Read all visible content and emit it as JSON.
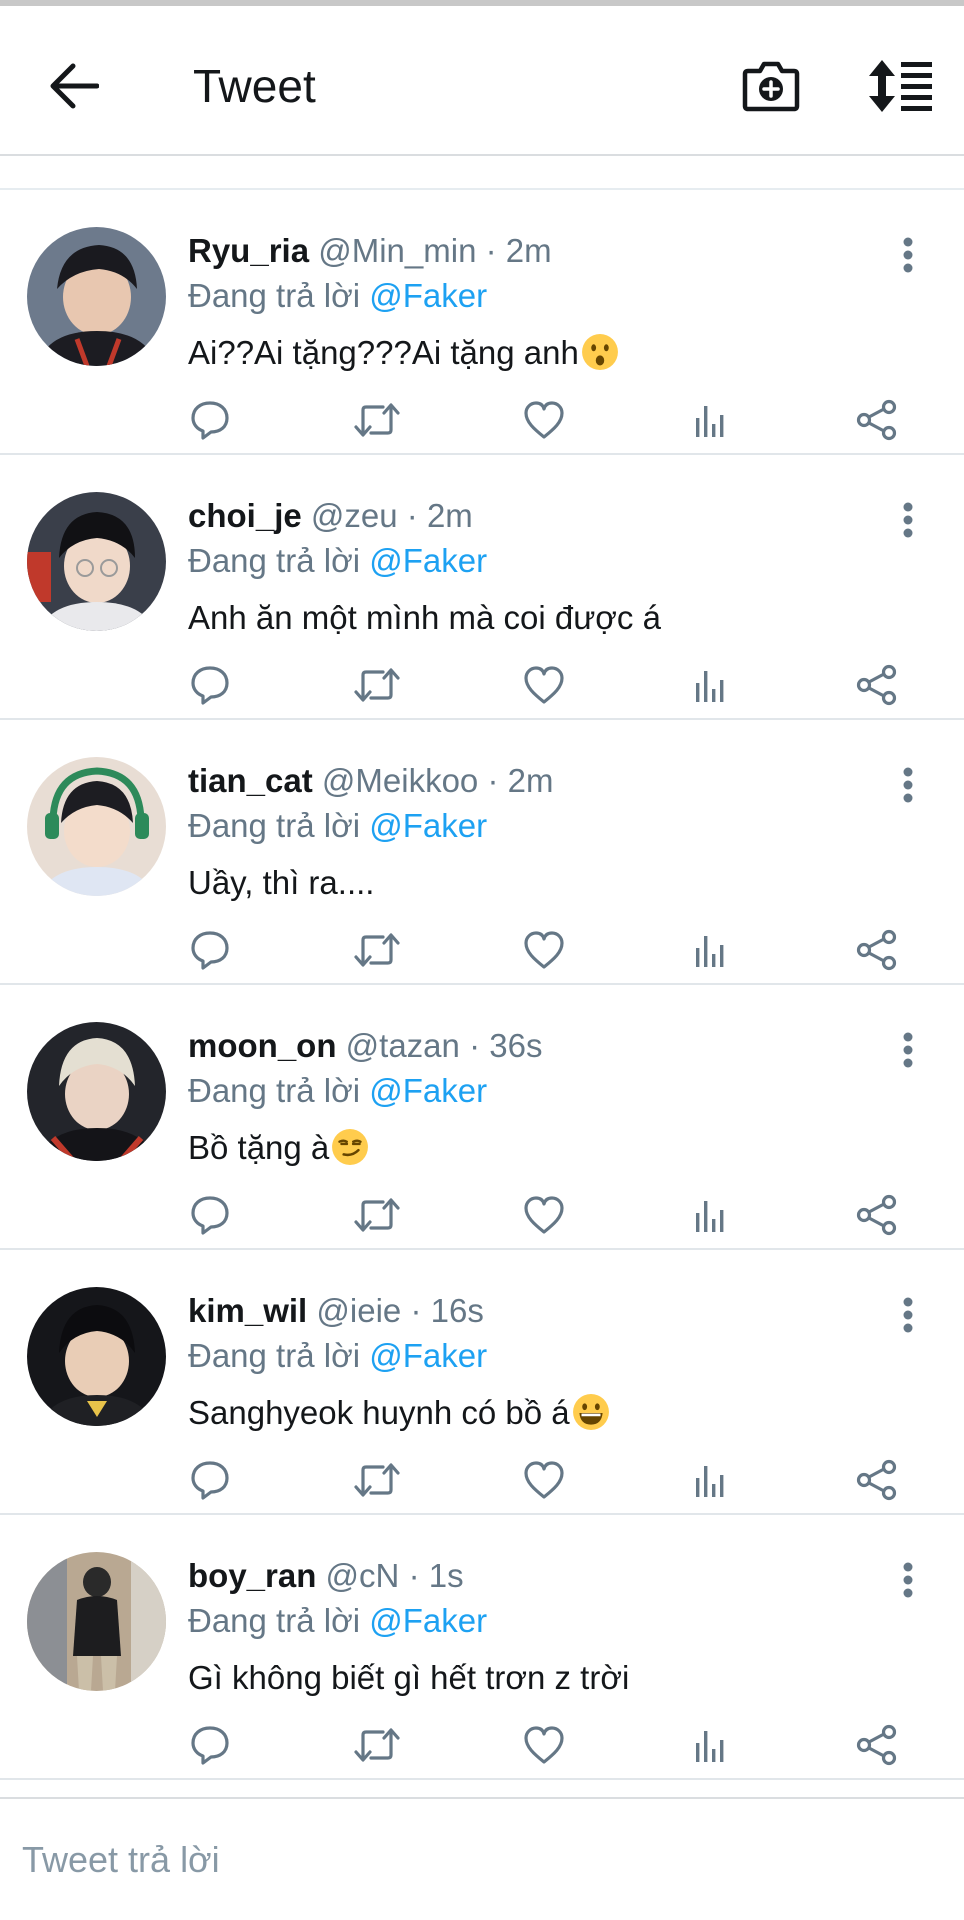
{
  "header": {
    "title": "Tweet",
    "back_icon": "arrow-left-icon",
    "camera_icon": "camera-plus-icon",
    "sort_icon": "sort-list-icon"
  },
  "colors": {
    "accent": "#1da1f2",
    "secondary_text": "#657786",
    "primary_text": "#14171a",
    "divider": "#e1e6ea"
  },
  "tweets": [
    {
      "name": "Ryu_ria",
      "handle": "@Min_min",
      "sep": "·",
      "time": "2m",
      "reply_prefix": "Đang trả lời",
      "reply_to": "@Faker",
      "text": "Ai??Ai tặng???Ai tặng anh",
      "emoji": "hushed-face"
    },
    {
      "name": "choi_je",
      "handle": "@zeu",
      "sep": "·",
      "time": "2m",
      "reply_prefix": "Đang trả lời",
      "reply_to": "@Faker",
      "text": "Anh ăn một mình mà coi được á",
      "emoji": ""
    },
    {
      "name": "tian_cat",
      "handle": "@Meikkoo",
      "sep": "·",
      "time": "2m",
      "reply_prefix": "Đang trả lời",
      "reply_to": "@Faker",
      "text": "Uầy, thì ra....",
      "emoji": ""
    },
    {
      "name": "moon_on",
      "handle": "@tazan",
      "sep": "·",
      "time": "36s",
      "reply_prefix": "Đang trả lời",
      "reply_to": "@Faker",
      "text": "Bồ tặng à",
      "emoji": "smirking-face"
    },
    {
      "name": "kim_wil",
      "handle": "@ieie",
      "sep": "·",
      "time": "16s",
      "reply_prefix": "Đang trả lời",
      "reply_to": "@Faker",
      "text": "Sanghyeok huynh có bồ á",
      "emoji": "grinning-face"
    },
    {
      "name": "boy_ran",
      "handle": "@cN",
      "sep": "·",
      "time": "1s",
      "reply_prefix": "Đang trả lời",
      "reply_to": "@Faker",
      "text": "Gì không biết gì hết trơn z trời",
      "emoji": ""
    }
  ],
  "action_icons": [
    "reply-icon",
    "retweet-icon",
    "like-icon",
    "stats-icon",
    "share-icon"
  ],
  "compose": {
    "placeholder": "Tweet trả lời",
    "value": ""
  }
}
